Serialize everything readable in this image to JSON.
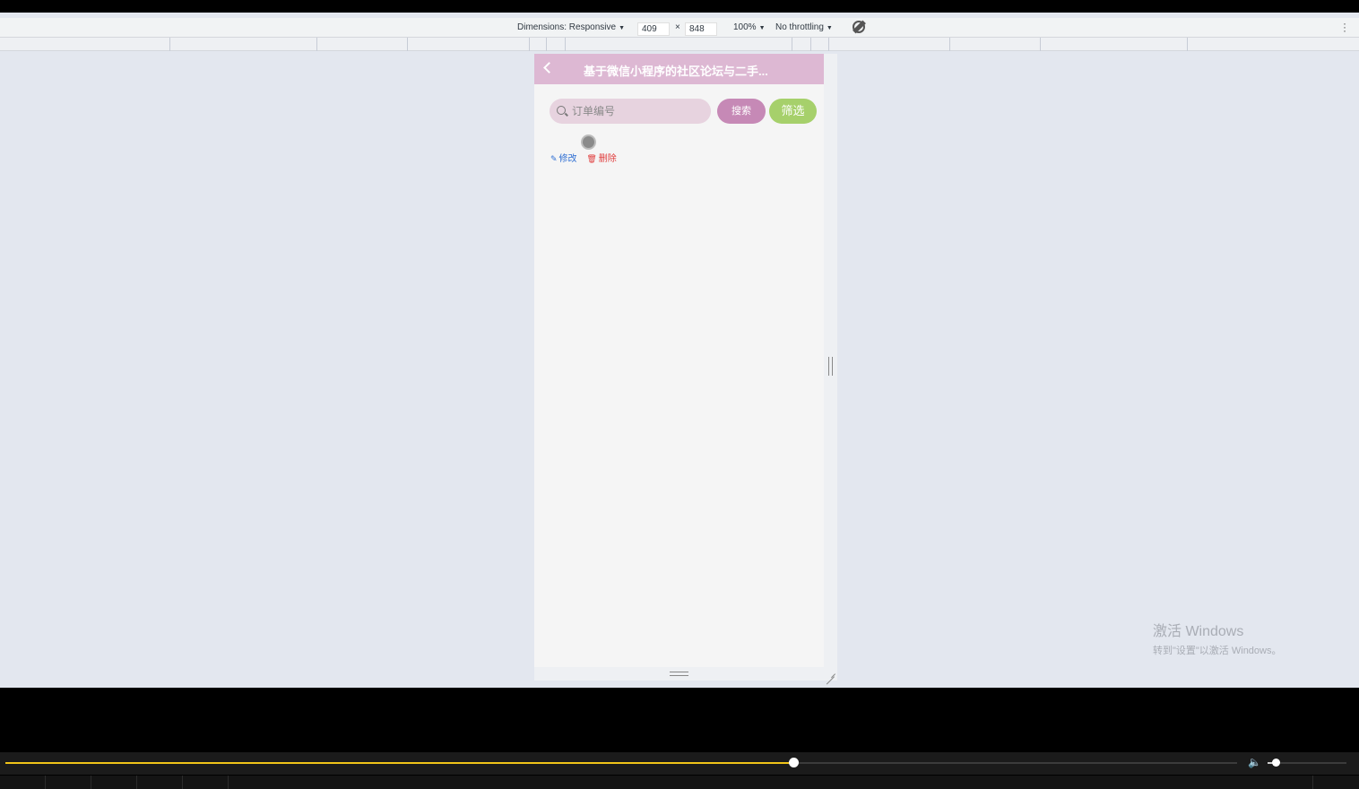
{
  "devtools": {
    "dimensions_label": "Dimensions: Responsive",
    "width": "409",
    "times": "×",
    "height": "848",
    "zoom": "100%",
    "throttling": "No throttling"
  },
  "app": {
    "title": "基于微信小程序的社区论坛与二手...",
    "search_placeholder": "订单编号",
    "search_button": "搜索",
    "filter_button": "筛选",
    "edit_action": "修改",
    "delete_action": "删除"
  },
  "watermark": {
    "title": "激活 Windows",
    "subtitle": "转到\"设置\"以激活 Windows。"
  },
  "player": {
    "progress_percent": 64,
    "volume_percent": 10
  },
  "colors": {
    "navbar": "#ddb8d3",
    "search_button": "#c689b6",
    "filter_button": "#a6d06b",
    "edit": "#2f6fd3",
    "delete": "#e03c3c",
    "progress": "#f0c419"
  }
}
